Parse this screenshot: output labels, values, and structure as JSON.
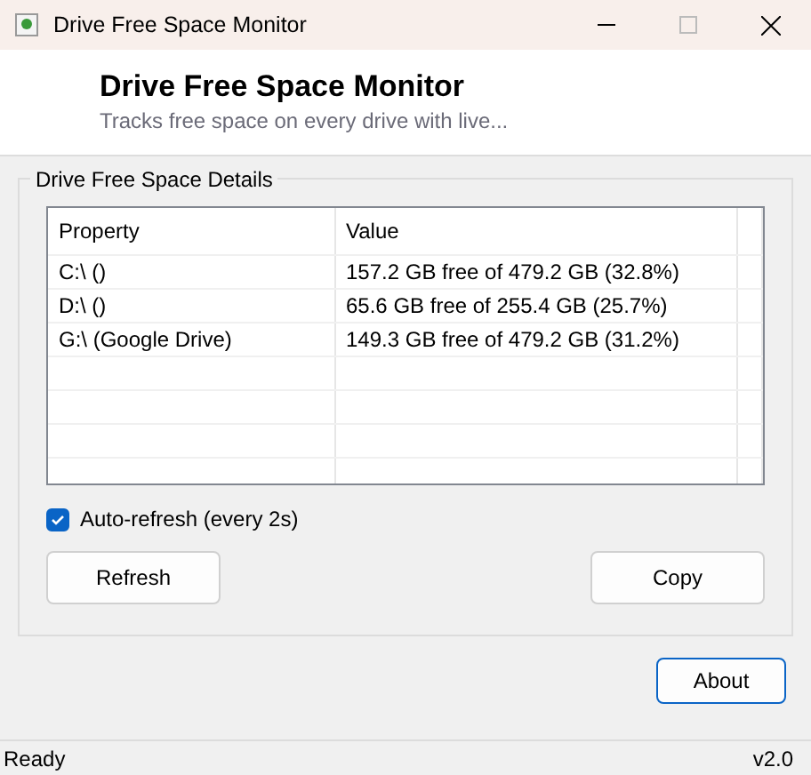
{
  "window": {
    "title": "Drive Free Space Monitor"
  },
  "header": {
    "title": "Drive Free Space Monitor",
    "subtitle": "Tracks free space on every drive with live..."
  },
  "group": {
    "title": "Drive Free Space Details",
    "table": {
      "columns": [
        "Property",
        "Value"
      ],
      "rows": [
        [
          "C:\\ ()",
          "157.2 GB free of 479.2 GB (32.8%)"
        ],
        [
          "D:\\ ()",
          "65.6 GB free of 255.4 GB (25.7%)"
        ],
        [
          "G:\\ (Google Drive)",
          "149.3 GB free of 479.2 GB (31.2%)"
        ]
      ]
    },
    "auto_refresh": {
      "label": "Auto-refresh (every 2s)",
      "checked": true
    },
    "buttons": [
      "Refresh",
      "Copy"
    ]
  },
  "about_button": {
    "label": "About",
    "focused": true
  },
  "status_bar": {
    "status": "Ready",
    "version": "v2.0"
  }
}
